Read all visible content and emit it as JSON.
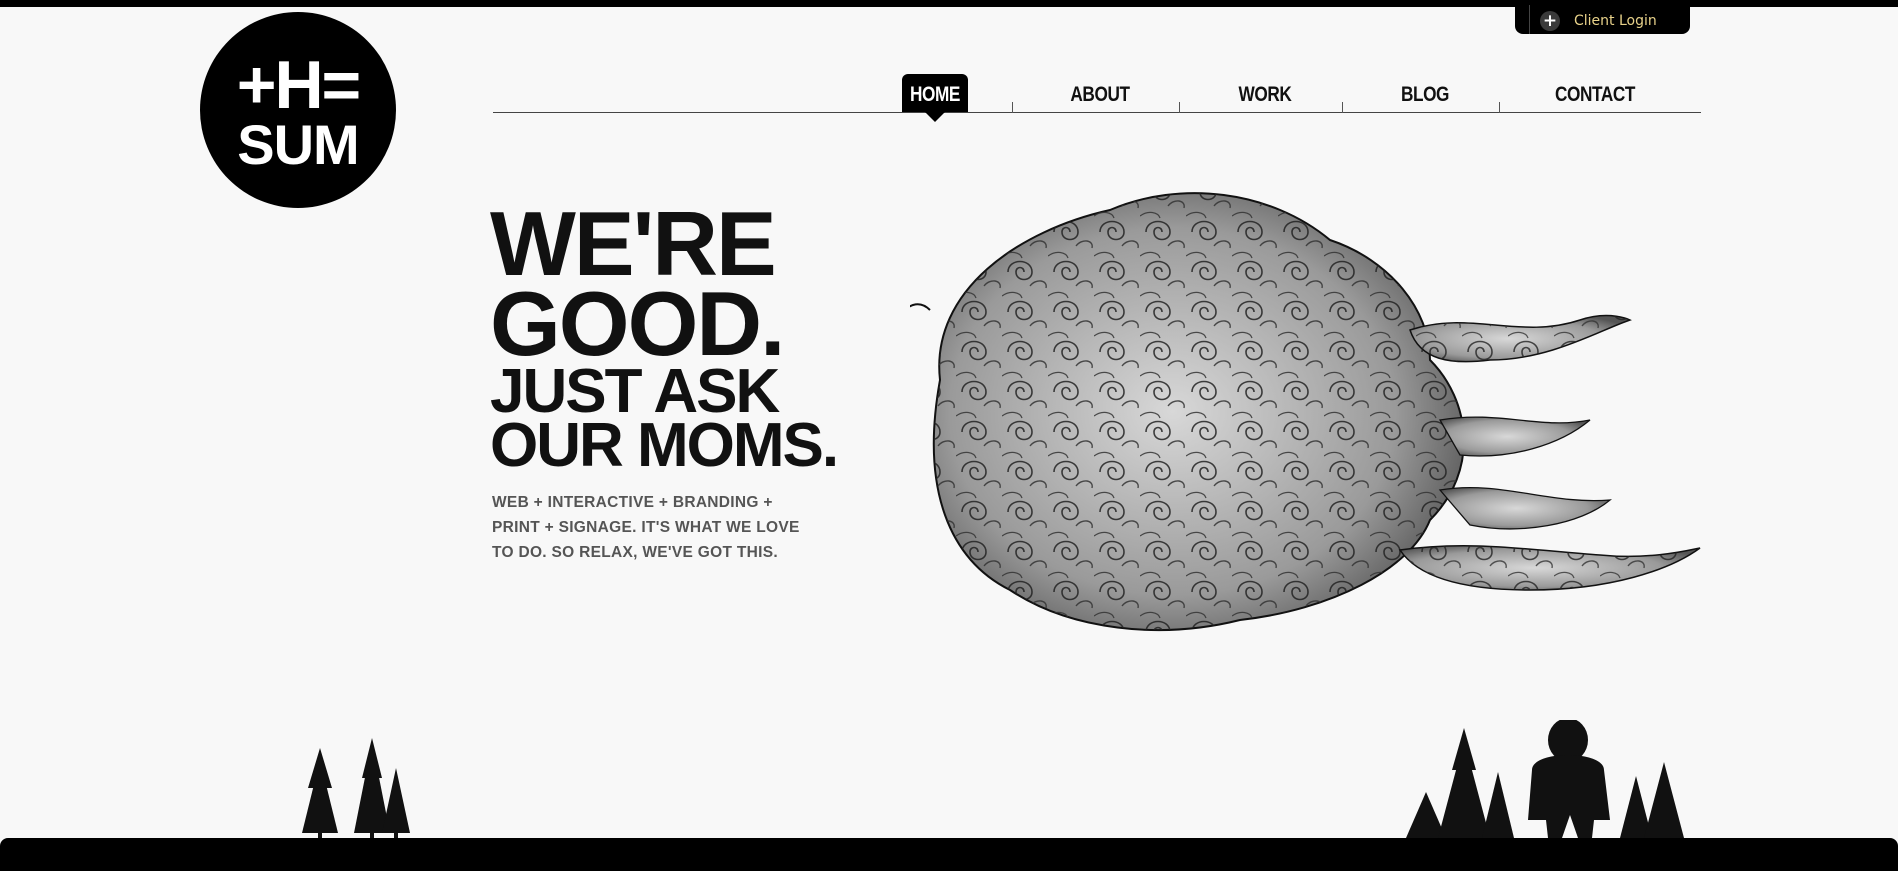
{
  "top_bar": {
    "client_login": {
      "icon": "plus-circle-icon",
      "label": "Client Login"
    }
  },
  "logo": {
    "line1": "+H=",
    "line2": "SUM"
  },
  "nav": {
    "items": [
      {
        "label": "HOME",
        "active": true
      },
      {
        "label": "ABOUT",
        "active": false
      },
      {
        "label": "WORK",
        "active": false
      },
      {
        "label": "BLOG",
        "active": false
      },
      {
        "label": "CONTACT",
        "active": false
      }
    ]
  },
  "hero": {
    "headline": [
      "WE'RE",
      "GOOD.",
      "JUST ASK",
      "OUR MOMS."
    ],
    "tagline": [
      "WEB + INTERACTIVE + BRANDING +",
      "PRINT + SIGNAGE. IT'S WHAT WE LOVE",
      "TO DO. SO RELAX, WE'VE GOT THIS."
    ]
  },
  "illustrations": {
    "cloud": "swirl-cloud-illustration",
    "left": "pine-trees-illustration",
    "right": "bigfoot-and-trees-illustration"
  },
  "colors": {
    "accent": "#000000",
    "login_text": "#e8d28a",
    "tagline": "#555555",
    "background": "#f8f8f8"
  }
}
